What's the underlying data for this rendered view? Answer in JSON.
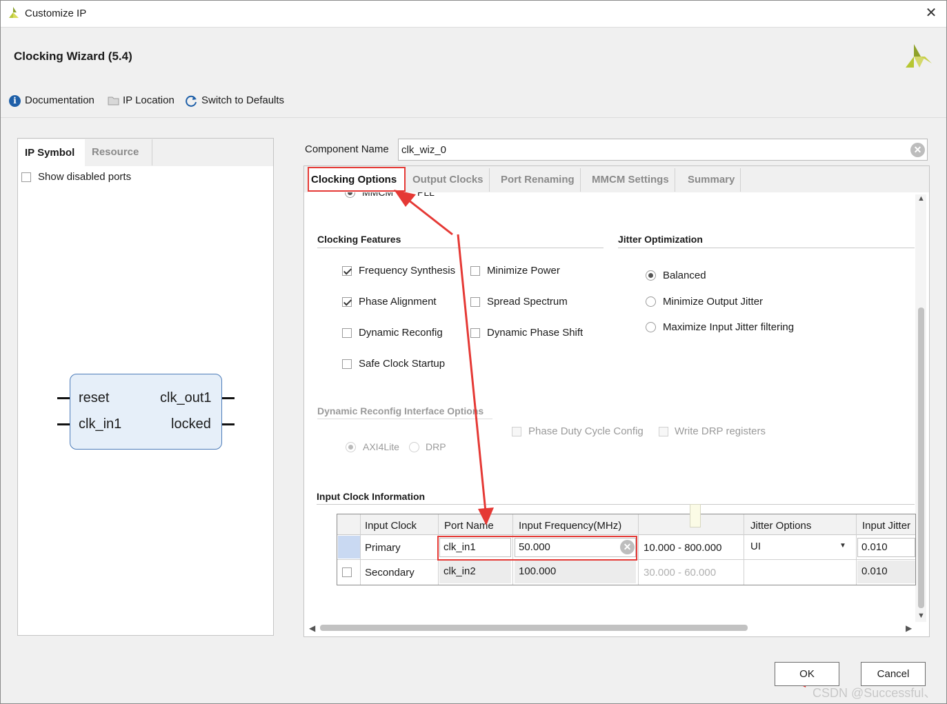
{
  "window": {
    "title": "Customize IP"
  },
  "header": {
    "title": "Clocking Wizard (5.4)",
    "toolbar": {
      "documentation": "Documentation",
      "ip_location": "IP Location",
      "switch_defaults": "Switch to Defaults"
    }
  },
  "left_panel": {
    "tabs": [
      "IP Symbol",
      "Resource"
    ],
    "show_disabled_ports": "Show disabled ports",
    "symbol": {
      "in_ports": [
        "reset",
        "clk_in1"
      ],
      "out_ports": [
        "clk_out1",
        "locked"
      ]
    }
  },
  "component": {
    "label": "Component Name",
    "value": "clk_wiz_0"
  },
  "tabs": [
    "Clocking Options",
    "Output Clocks",
    "Port Renaming",
    "MMCM Settings",
    "Summary"
  ],
  "partial_radio": {
    "mmcm": "MMCM",
    "pll": "PLL"
  },
  "clocking_features": {
    "title": "Clocking Features",
    "items": [
      {
        "label": "Frequency Synthesis",
        "checked": true
      },
      {
        "label": "Minimize Power",
        "checked": false
      },
      {
        "label": "Phase Alignment",
        "checked": true
      },
      {
        "label": "Spread Spectrum",
        "checked": false
      },
      {
        "label": "Dynamic Reconfig",
        "checked": false
      },
      {
        "label": "Dynamic Phase Shift",
        "checked": false
      },
      {
        "label": "Safe Clock Startup",
        "checked": false
      }
    ]
  },
  "jitter_optimization": {
    "title": "Jitter Optimization",
    "options": [
      "Balanced",
      "Minimize Output Jitter",
      "Maximize Input Jitter filtering"
    ],
    "selected": "Balanced"
  },
  "dynamic_reconfig": {
    "title": "Dynamic Reconfig Interface Options",
    "interface": [
      "AXI4Lite",
      "DRP"
    ],
    "phase_duty": "Phase Duty Cycle Config",
    "write_drp": "Write DRP registers"
  },
  "input_clock": {
    "title": "Input Clock Information",
    "headers": [
      "Input Clock",
      "Port Name",
      "Input Frequency(MHz)",
      "",
      "Jitter Options",
      "Input Jitter"
    ],
    "rows": [
      {
        "clock": "Primary",
        "port": "clk_in1",
        "freq": "50.000",
        "range": "10.000 - 800.000",
        "jitter_opt": "UI",
        "jitter": "0.010"
      },
      {
        "clock": "Secondary",
        "port": "clk_in2",
        "freq": "100.000",
        "range": "30.000 - 60.000",
        "jitter_opt": "",
        "jitter": "0.010"
      }
    ]
  },
  "buttons": {
    "ok": "OK",
    "cancel": "Cancel"
  },
  "watermark": "CSDN @Successful、",
  "colors": {
    "highlight_red": "#e53935",
    "symbol_fill": "#e6eff9",
    "symbol_border": "#4a7ab8"
  }
}
